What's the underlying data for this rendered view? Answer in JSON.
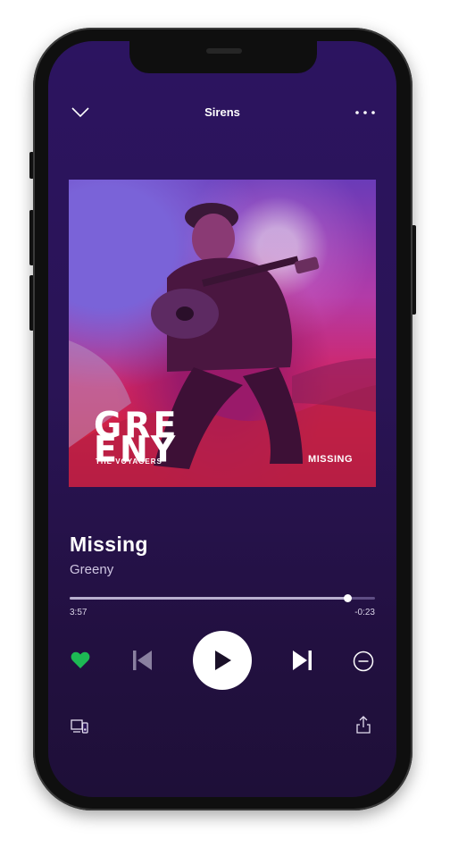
{
  "header": {
    "title": "Sirens",
    "collapse_icon": "chevron-down-icon",
    "more_icon": "more-horizontal-icon"
  },
  "album_art": {
    "logo_line1": "GRE",
    "logo_line2": "ENY",
    "logo_sub": "THE VOYAGERS",
    "album_label": "MISSING"
  },
  "track": {
    "title": "Missing",
    "artist": "Greeny"
  },
  "playback": {
    "elapsed": "3:57",
    "remaining": "-0:23",
    "progress": 0.91
  },
  "controls": {
    "like_icon": "heart-icon",
    "previous_icon": "skip-back-icon",
    "play_icon": "play-icon",
    "next_icon": "skip-forward-icon",
    "hide_icon": "minus-circle-icon",
    "devices_icon": "devices-icon",
    "share_icon": "share-icon"
  },
  "colors": {
    "accent": "#1db954",
    "background": "#2a1456",
    "text": "#ffffff"
  }
}
